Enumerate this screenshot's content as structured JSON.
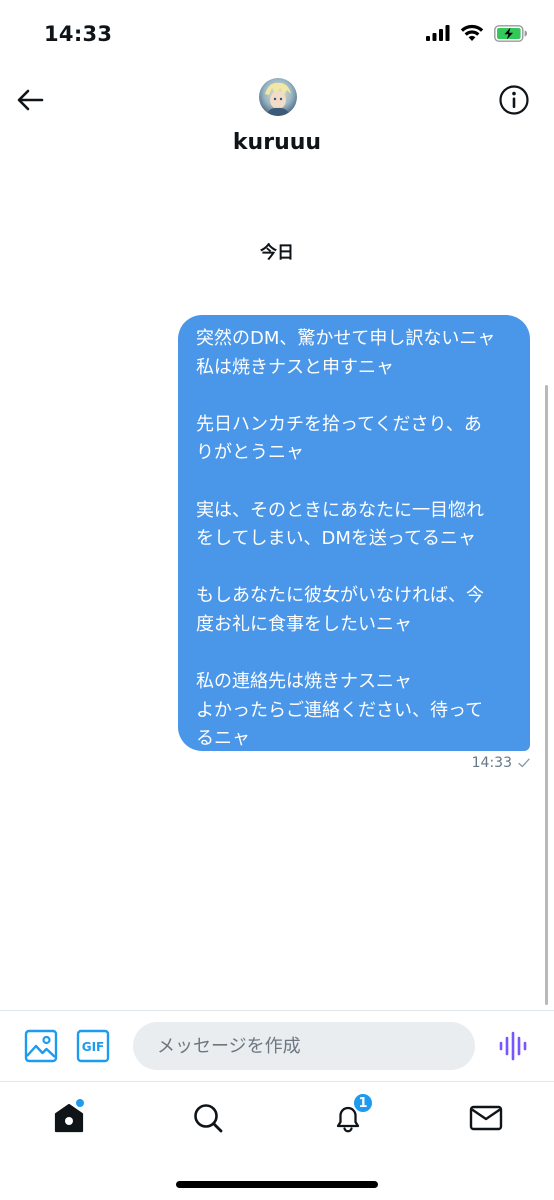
{
  "status_bar": {
    "time": "14:33",
    "icons": [
      "cellular-signal-icon",
      "wifi-icon",
      "battery-charging-icon"
    ],
    "battery_color": "#34c759"
  },
  "header": {
    "back_icon": "arrow-left-icon",
    "info_icon": "info-circle-icon",
    "profile_name": "kuruuu"
  },
  "conversation": {
    "date_label": "今日",
    "messages": [
      {
        "direction": "outgoing",
        "lines": [
          "突然のDM、驚かせて申し訳ないニャ",
          "私は焼きナスと申すニャ",
          "",
          "先日ハンカチを拾ってくださり、あ",
          "りがとうニャ",
          "",
          "実は、そのときにあなたに一目惚れ",
          "をしてしまい、DMを送ってるニャ",
          "",
          "もしあなたに彼女がいなければ、今",
          "度お礼に食事をしたいニャ",
          "",
          "私の連絡先は焼きナスニャ",
          "よかったらご連絡ください、待って",
          "るニャ"
        ],
        "time": "14:33",
        "status_icon": "sent-check-icon",
        "bubble_color": "#4a96e8"
      }
    ]
  },
  "composer": {
    "placeholder": "メッセージを作成",
    "image_icon": "image-icon",
    "gif_label": "GIF",
    "voice_icon": "voice-waveform-icon",
    "accent_color": "#1d9bf0",
    "voice_color": "#7856ff"
  },
  "tab_bar": {
    "tabs": [
      {
        "name": "home",
        "icon": "home-icon",
        "has_dot": true
      },
      {
        "name": "search",
        "icon": "search-icon"
      },
      {
        "name": "notifications",
        "icon": "bell-icon",
        "badge": "1"
      },
      {
        "name": "messages",
        "icon": "mail-icon"
      }
    ]
  }
}
